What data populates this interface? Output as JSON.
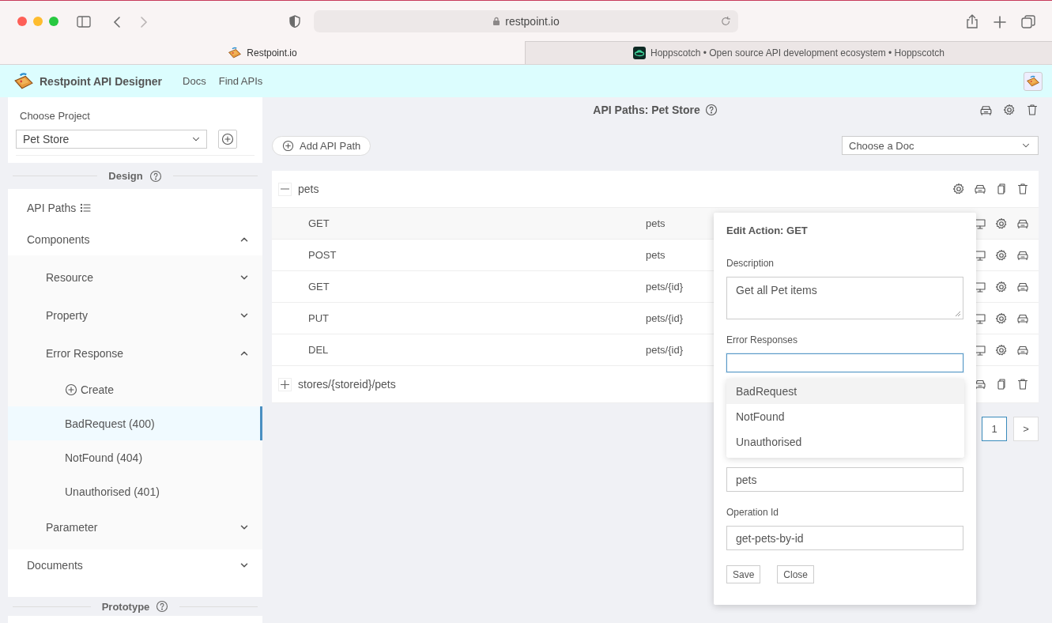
{
  "browser": {
    "url": "restpoint.io",
    "tabs": [
      {
        "title": "Restpoint.io",
        "selected": true,
        "kind": "board"
      },
      {
        "title": "Hoppscotch • Open source API development ecosystem • Hoppscotch",
        "selected": false,
        "kind": "saucer"
      }
    ]
  },
  "header": {
    "title": "Restpoint API Designer",
    "links": [
      "Docs",
      "Find APIs"
    ]
  },
  "sidebar": {
    "project_label": "Choose Project",
    "project": "Pet Store",
    "design_heading": "Design",
    "prototype_heading": "Prototype",
    "nav": [
      {
        "label": "API Paths",
        "kind": "list"
      },
      {
        "label": "Components",
        "kind": "group",
        "expanded": true,
        "children": [
          {
            "label": "Resource",
            "kind": "group",
            "expanded": false
          },
          {
            "label": "Property",
            "kind": "group",
            "expanded": false
          },
          {
            "label": "Error Response",
            "kind": "group",
            "expanded": true,
            "children": [
              {
                "label": "Create",
                "kind": "create"
              },
              {
                "label": "BadRequest (400)",
                "kind": "item",
                "selected": true
              },
              {
                "label": "NotFound (404)",
                "kind": "item",
                "selected": false
              },
              {
                "label": "Unauthorised (401)",
                "kind": "item",
                "selected": false
              }
            ]
          },
          {
            "label": "Parameter",
            "kind": "group",
            "expanded": false
          }
        ]
      },
      {
        "label": "Documents",
        "kind": "group",
        "expanded": false
      }
    ]
  },
  "main": {
    "title": "API Paths: Pet Store",
    "add_button": "Add API Path",
    "doc_select": "Choose a Doc",
    "groups": [
      {
        "path": "pets",
        "expanded": true,
        "actions": [
          {
            "kind": "settings"
          },
          {
            "kind": "car"
          },
          {
            "kind": "copy"
          },
          {
            "kind": "delete"
          }
        ],
        "operations": [
          {
            "method": "GET",
            "path": "pets",
            "selected": true
          },
          {
            "method": "POST",
            "path": "pets",
            "selected": false
          },
          {
            "method": "GET",
            "path": "pets/{id}",
            "selected": false
          },
          {
            "method": "PUT",
            "path": "pets/{id}",
            "selected": false
          },
          {
            "method": "DEL",
            "path": "pets/{id}",
            "selected": false
          }
        ]
      },
      {
        "path": "stores/{storeid}/pets",
        "expanded": false,
        "actions": [
          {
            "kind": "car"
          },
          {
            "kind": "copy"
          },
          {
            "kind": "delete"
          }
        ]
      }
    ],
    "pagination": [
      {
        "label": "1",
        "selected": true
      },
      {
        "label": ">",
        "selected": false
      }
    ]
  },
  "popover": {
    "title": "Edit Action: GET",
    "fields": [
      {
        "kind": "textarea",
        "label": "Description",
        "value": "Get all Pet items"
      },
      {
        "kind": "combo",
        "label": "Error Responses",
        "focused": true,
        "options": [
          {
            "label": "BadRequest",
            "selected": true
          },
          {
            "label": "NotFound",
            "selected": false
          },
          {
            "label": "Unauthorised",
            "selected": false
          }
        ]
      },
      {
        "kind": "input",
        "value": "pets"
      },
      {
        "kind": "input",
        "label": "Operation Id",
        "value": "get-pets-by-id"
      }
    ],
    "buttons": [
      "Save",
      "Close"
    ]
  }
}
